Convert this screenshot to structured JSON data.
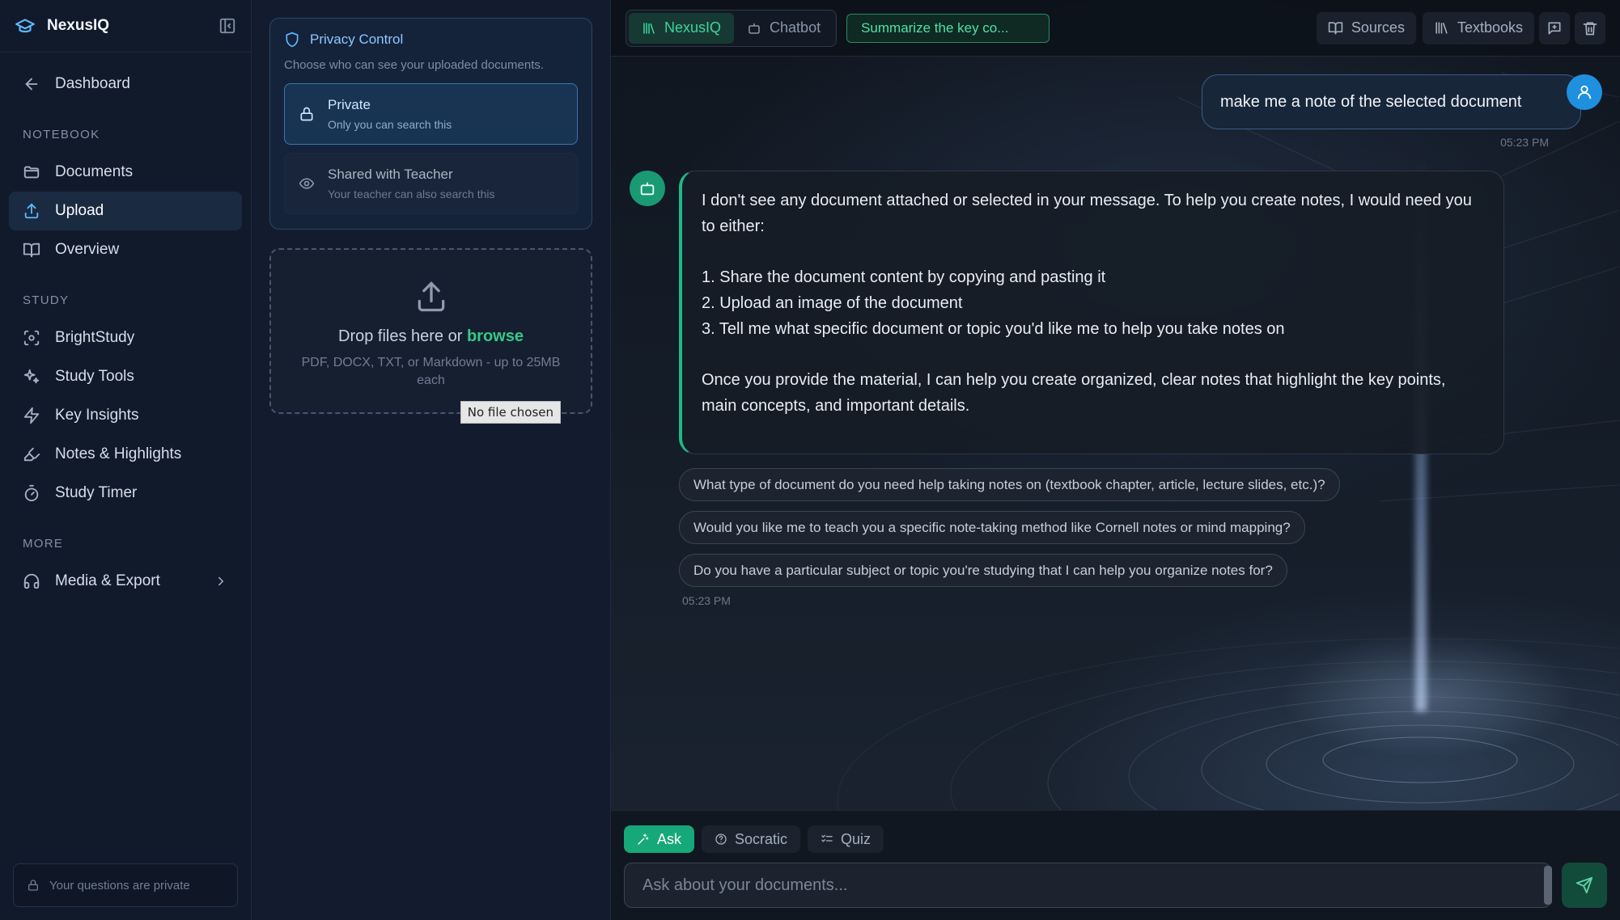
{
  "app": {
    "name": "NexusIQ"
  },
  "sidebar": {
    "dashboard_label": "Dashboard",
    "sections": {
      "notebook": "NOTEBOOK",
      "study": "STUDY",
      "more": "MORE"
    },
    "notebook_items": [
      "Documents",
      "Upload",
      "Overview"
    ],
    "study_items": [
      "BrightStudy",
      "Study Tools",
      "Key Insights",
      "Notes & Highlights",
      "Study Timer"
    ],
    "more_items": [
      "Media & Export"
    ],
    "active_item": "Upload",
    "footer_text": "Your questions are private"
  },
  "privacy": {
    "title": "Privacy Control",
    "subtitle": "Choose who can see your uploaded documents.",
    "options": [
      {
        "title": "Private",
        "subtitle": "Only you can search this",
        "selected": true
      },
      {
        "title": "Shared with Teacher",
        "subtitle": "Your teacher can also search this",
        "selected": false
      }
    ]
  },
  "upload": {
    "drop_text": "Drop files here or",
    "browse_label": "browse",
    "hint": "PDF, DOCX, TXT, or Markdown - up to 25MB each",
    "file_status": "No file chosen"
  },
  "topbar": {
    "tabs": [
      "NexusIQ",
      "Chatbot"
    ],
    "active_tab": "NexusIQ",
    "suggestion": "Summarize the key co...",
    "sources_label": "Sources",
    "textbooks_label": "Textbooks"
  },
  "chat": {
    "user_message": "make me a note of the selected document",
    "user_time": "05:23 PM",
    "bot_intro": "I don't see any document attached or selected in your message. To help you create notes, I would need you to either:",
    "bot_list": [
      "1. Share the document content by copying and pasting it",
      "2. Upload an image of the document",
      "3. Tell me what specific document or topic you'd like me to help you take notes on"
    ],
    "bot_outro": "Once you provide the material, I can help you create organized, clear notes that highlight the key points, main concepts, and important details.",
    "followups": [
      "What type of document do you need help taking notes on (textbook chapter, article, lecture slides, etc.)?",
      "Would you like me to teach you a specific note-taking method like Cornell notes or mind mapping?",
      "Do you have a particular subject or topic you're studying that I can help you organize notes for?"
    ],
    "bot_time": "05:23 PM"
  },
  "composer": {
    "modes": [
      "Ask",
      "Socratic",
      "Quiz"
    ],
    "active_mode": "Ask",
    "placeholder": "Ask about your documents..."
  },
  "colors": {
    "accent_green": "#1fb986",
    "accent_blue": "#5fb8ff",
    "background": "#0b1220"
  }
}
